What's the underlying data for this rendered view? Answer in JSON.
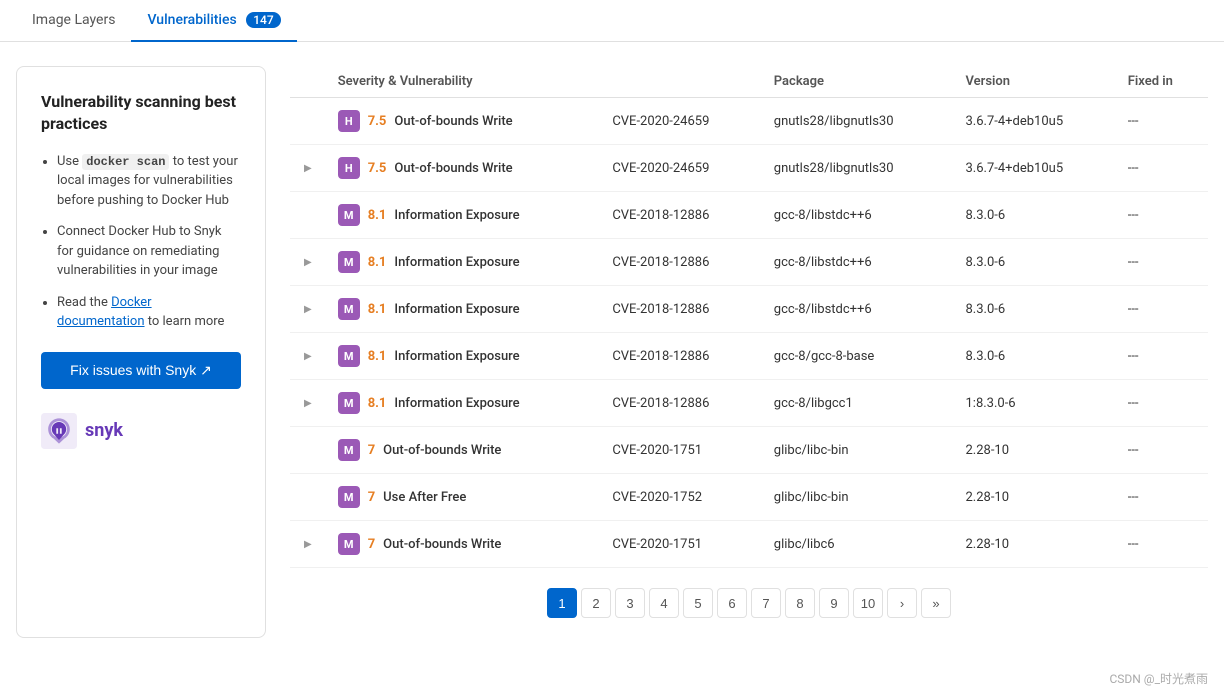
{
  "tabs": [
    {
      "id": "image-layers",
      "label": "Image Layers",
      "badge": null,
      "active": false
    },
    {
      "id": "vulnerabilities",
      "label": "Vulnerabilities",
      "badge": "147",
      "active": true
    }
  ],
  "table": {
    "columns": [
      {
        "id": "severity",
        "label": "Severity & Vulnerability"
      },
      {
        "id": "cve",
        "label": ""
      },
      {
        "id": "package",
        "label": "Package"
      },
      {
        "id": "version",
        "label": "Version"
      },
      {
        "id": "fixed_in",
        "label": "Fixed in"
      }
    ],
    "rows": [
      {
        "expand": false,
        "badge": "H",
        "score": "7.5",
        "name": "Out-of-bounds Write",
        "cve": "CVE-2020-24659",
        "package": "gnutls28/libgnutls30",
        "version": "3.6.7-4+deb10u5",
        "fixed_in": "---",
        "expandable": false
      },
      {
        "expand": true,
        "badge": "H",
        "score": "7.5",
        "name": "Out-of-bounds Write",
        "cve": "CVE-2020-24659",
        "package": "gnutls28/libgnutls30",
        "version": "3.6.7-4+deb10u5",
        "fixed_in": "---",
        "expandable": true
      },
      {
        "expand": false,
        "badge": "M",
        "score": "8.1",
        "name": "Information Exposure",
        "cve": "CVE-2018-12886",
        "package": "gcc-8/libstdc++6",
        "version": "8.3.0-6",
        "fixed_in": "---",
        "expandable": false
      },
      {
        "expand": true,
        "badge": "M",
        "score": "8.1",
        "name": "Information Exposure",
        "cve": "CVE-2018-12886",
        "package": "gcc-8/libstdc++6",
        "version": "8.3.0-6",
        "fixed_in": "---",
        "expandable": true
      },
      {
        "expand": true,
        "badge": "M",
        "score": "8.1",
        "name": "Information Exposure",
        "cve": "CVE-2018-12886",
        "package": "gcc-8/libstdc++6",
        "version": "8.3.0-6",
        "fixed_in": "---",
        "expandable": true
      },
      {
        "expand": true,
        "badge": "M",
        "score": "8.1",
        "name": "Information Exposure",
        "cve": "CVE-2018-12886",
        "package": "gcc-8/gcc-8-base",
        "version": "8.3.0-6",
        "fixed_in": "---",
        "expandable": true
      },
      {
        "expand": true,
        "badge": "M",
        "score": "8.1",
        "name": "Information Exposure",
        "cve": "CVE-2018-12886",
        "package": "gcc-8/libgcc1",
        "version": "1:8.3.0-6",
        "fixed_in": "---",
        "expandable": true
      },
      {
        "expand": false,
        "badge": "M",
        "score": "7",
        "name": "Out-of-bounds Write",
        "cve": "CVE-2020-1751",
        "package": "glibc/libc-bin",
        "version": "2.28-10",
        "fixed_in": "---",
        "expandable": false
      },
      {
        "expand": false,
        "badge": "M",
        "score": "7",
        "name": "Use After Free",
        "cve": "CVE-2020-1752",
        "package": "glibc/libc-bin",
        "version": "2.28-10",
        "fixed_in": "---",
        "expandable": false
      },
      {
        "expand": true,
        "badge": "M",
        "score": "7",
        "name": "Out-of-bounds Write",
        "cve": "CVE-2020-1751",
        "package": "glibc/libc6",
        "version": "2.28-10",
        "fixed_in": "---",
        "expandable": true
      }
    ]
  },
  "pagination": {
    "pages": [
      "1",
      "2",
      "3",
      "4",
      "5",
      "6",
      "7",
      "8",
      "9",
      "10"
    ],
    "active_page": "1",
    "prev_label": "‹",
    "next_label": "›",
    "last_label": "»"
  },
  "sidebar": {
    "title": "Vulnerability scanning best practices",
    "items": [
      {
        "text_before": "Use ",
        "code": "docker scan",
        "text_after": " to test your local images for vulnerabilities before pushing to Docker Hub"
      },
      {
        "text_before": "Connect Docker Hub to Snyk for guidance on remediating vulnerabilities in your image",
        "code": null,
        "text_after": null
      },
      {
        "text_before": "Read the ",
        "link_text": "Docker documentation",
        "text_after": " to learn more"
      }
    ],
    "fix_button_label": "Fix issues with Snyk ↗",
    "snyk_text": "snyk"
  },
  "watermark": "CSDN @_时光煮雨"
}
